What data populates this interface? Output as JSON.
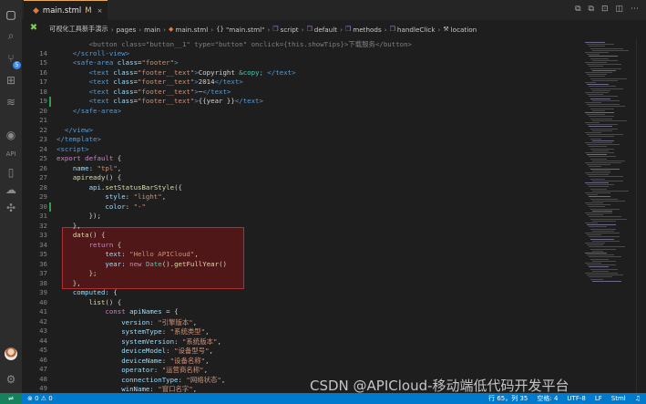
{
  "tab": {
    "file_name": "main.stml",
    "modified_marker": "M",
    "close": "×"
  },
  "breadcrumb": {
    "items": [
      "可视化工具新手演示",
      "pages",
      "main",
      "main.stml",
      "\"main.stml\"",
      "script",
      "default",
      "methods",
      "handleClick",
      "location"
    ],
    "icons": [
      "",
      "",
      "",
      "stml-icon",
      "brackets-icon",
      "cube-icon",
      "cube-icon",
      "cube-icon",
      "cube-icon",
      "wrench-icon"
    ]
  },
  "activity_bar": {
    "icons": [
      "files-icon",
      "search-icon",
      "source-control-icon",
      "extensions-icon",
      "layers-icon",
      "eye-icon",
      "api-label",
      "book-icon",
      "cloud-icon",
      "puzzle-icon"
    ],
    "source_control_badge": "5",
    "api_label": "API"
  },
  "editor": {
    "lines": [
      {
        "n": "",
        "html": "        <span class='t-dim'>&lt;button class=\"button__1\" type=\"button\" onclick={this.showTips}&gt;下载服务&lt;/button&gt;</span>"
      },
      {
        "n": "14",
        "html": "    <span class='t-tag'>&lt;/scroll-view&gt;</span>"
      },
      {
        "n": "15",
        "html": "    <span class='t-tag'>&lt;safe-area</span> <span class='t-attr'>class</span>=<span class='t-str'>\"footer\"</span><span class='t-tag'>&gt;</span>"
      },
      {
        "n": "16",
        "html": "        <span class='t-tag'>&lt;text</span> <span class='t-attr'>class</span>=<span class='t-str'>\"footer__text\"</span><span class='t-tag'>&gt;</span>Copyright <span class='t-cls'>&amp;copy;</span> <span class='t-tag'>&lt;/text&gt;</span>"
      },
      {
        "n": "17",
        "html": "        <span class='t-tag'>&lt;text</span> <span class='t-attr'>class</span>=<span class='t-str'>\"footer__text\"</span><span class='t-tag'>&gt;</span>2014<span class='t-tag'>&lt;/text&gt;</span>"
      },
      {
        "n": "18",
        "html": "        <span class='t-tag'>&lt;text</span> <span class='t-attr'>class</span>=<span class='t-str'>\"footer__text\"</span><span class='t-tag'>&gt;</span>~<span class='t-tag'>&lt;/text&gt;</span>"
      },
      {
        "n": "19",
        "html": "        <span class='t-tag'>&lt;text</span> <span class='t-attr'>class</span>=<span class='t-str'>\"footer__text\"</span><span class='t-tag'>&gt;</span>{{year }}<span class='t-tag'>&lt;/text&gt;</span>"
      },
      {
        "n": "20",
        "html": "    <span class='t-tag'>&lt;/safe-area&gt;</span>"
      },
      {
        "n": "21",
        "html": ""
      },
      {
        "n": "22",
        "html": "  <span class='t-tag'>&lt;/view&gt;</span>"
      },
      {
        "n": "23",
        "html": "<span class='t-tag'>&lt;/template&gt;</span>"
      },
      {
        "n": "24",
        "html": "<span class='t-tag'>&lt;script&gt;</span>"
      },
      {
        "n": "25",
        "html": "<span class='t-kw'>export default</span> {"
      },
      {
        "n": "26",
        "html": "    <span class='t-attr'>name</span>: <span class='t-str'>\"tpl\"</span>,"
      },
      {
        "n": "27",
        "html": "    <span class='t-fn'>apiready</span>() {"
      },
      {
        "n": "28",
        "html": "        <span class='t-attr'>api</span>.<span class='t-fn'>setStatusBarStyle</span>({"
      },
      {
        "n": "29",
        "html": "            <span class='t-attr'>style</span>: <span class='t-str'>\"light\"</span>,"
      },
      {
        "n": "30",
        "html": "            <span class='t-attr'>color</span>: <span class='t-str'>\"-\"</span>"
      },
      {
        "n": "31",
        "html": "        });"
      },
      {
        "n": "32",
        "html": "    },"
      },
      {
        "n": "33",
        "html": "    <span class='t-fn'>data</span>() {"
      },
      {
        "n": "34",
        "html": "        <span class='t-kw'>return</span> {"
      },
      {
        "n": "35",
        "html": "            <span class='t-attr'>text</span>: <span class='t-str'>\"Hello APICloud\"</span>,"
      },
      {
        "n": "36",
        "html": "            <span class='t-attr'>year</span>: <span class='t-kw'>new</span> <span class='t-cls'>Date</span>().<span class='t-fn'>getFullYear</span>()"
      },
      {
        "n": "37",
        "html": "        };"
      },
      {
        "n": "38",
        "html": "    },"
      },
      {
        "n": "39",
        "html": "    <span class='t-attr'>computed</span>: {"
      },
      {
        "n": "40",
        "html": "        <span class='t-fn'>list</span>() {"
      },
      {
        "n": "41",
        "html": "            <span class='t-kw'>const</span> <span class='t-attr'>apiNames</span> = {"
      },
      {
        "n": "42",
        "html": "                <span class='t-attr'>version</span>: <span class='t-str'>\"引擎版本\"</span>,"
      },
      {
        "n": "43",
        "html": "                <span class='t-attr'>systemType</span>: <span class='t-str'>\"系统类型\"</span>,"
      },
      {
        "n": "44",
        "html": "                <span class='t-attr'>systemVersion</span>: <span class='t-str'>\"系统版本\"</span>,"
      },
      {
        "n": "45",
        "html": "                <span class='t-attr'>deviceModel</span>: <span class='t-str'>\"设备型号\"</span>,"
      },
      {
        "n": "46",
        "html": "                <span class='t-attr'>deviceName</span>: <span class='t-str'>\"设备名称\"</span>,"
      },
      {
        "n": "47",
        "html": "                <span class='t-attr'>operator</span>: <span class='t-str'>\"运营商名称\"</span>,"
      },
      {
        "n": "48",
        "html": "                <span class='t-attr'>connectionType</span>: <span class='t-str'>\"网络状态\"</span>,"
      },
      {
        "n": "49",
        "html": "                <span class='t-attr'>winName</span>: <span class='t-str'>\"窗口名字\"</span>,"
      }
    ],
    "modified_lines": [
      "19",
      "30"
    ]
  },
  "statusbar": {
    "problems": "⊗ 0 ⚠ 0",
    "position": "行 65，列 35",
    "spaces": "空格: 4",
    "encoding": "UTF-8",
    "eol": "LF",
    "language": "Stml",
    "notifications_icon": "bell-icon"
  },
  "watermark": "CSDN @APICloud-移动端低代码开发平台"
}
